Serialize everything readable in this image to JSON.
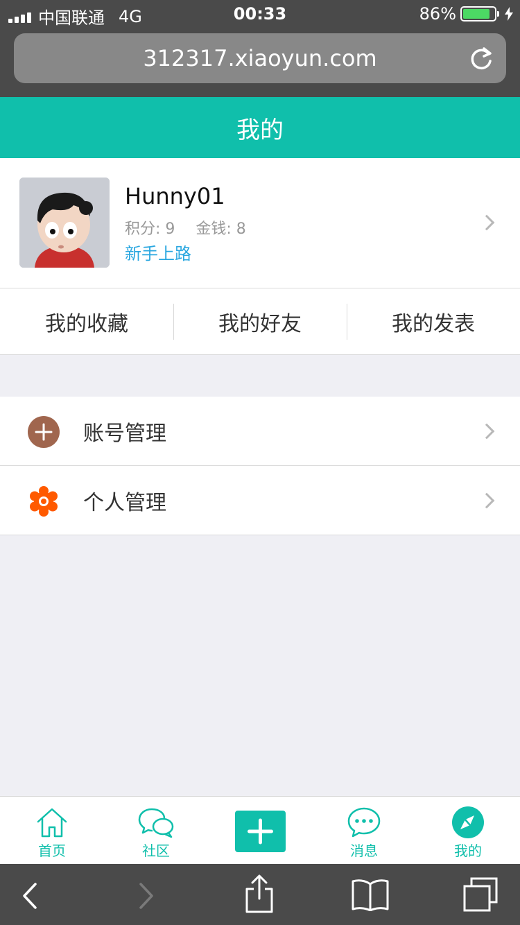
{
  "status_bar": {
    "carrier": "中国联通",
    "network": "4G",
    "time": "00:33",
    "battery_percent": "86%",
    "battery_level": 0.86
  },
  "browser": {
    "url": "312317.xiaoyun.com",
    "reload_icon": "reload-icon"
  },
  "header": {
    "title": "我的"
  },
  "profile": {
    "username": "Hunny01",
    "points_label": "积分: 9",
    "money_label": "金钱: 8",
    "level": "新手上路"
  },
  "quick_links": [
    {
      "label": "我的收藏"
    },
    {
      "label": "我的好友"
    },
    {
      "label": "我的发表"
    }
  ],
  "menu": [
    {
      "label": "账号管理",
      "icon": "plus-circle-icon",
      "color": "#a0664e"
    },
    {
      "label": "个人管理",
      "icon": "gear-icon",
      "color": "#ff5a00"
    }
  ],
  "tabbar": {
    "items": [
      {
        "label": "首页",
        "icon": "home-icon"
      },
      {
        "label": "社区",
        "icon": "chat-bubbles-icon"
      },
      {
        "label": "",
        "icon": "plus-icon"
      },
      {
        "label": "消息",
        "icon": "message-icon"
      },
      {
        "label": "我的",
        "icon": "compass-icon"
      }
    ]
  },
  "colors": {
    "accent": "#10bfab",
    "link": "#2aa7e0",
    "chrome": "#4a4a4a",
    "background": "#efeff4"
  }
}
